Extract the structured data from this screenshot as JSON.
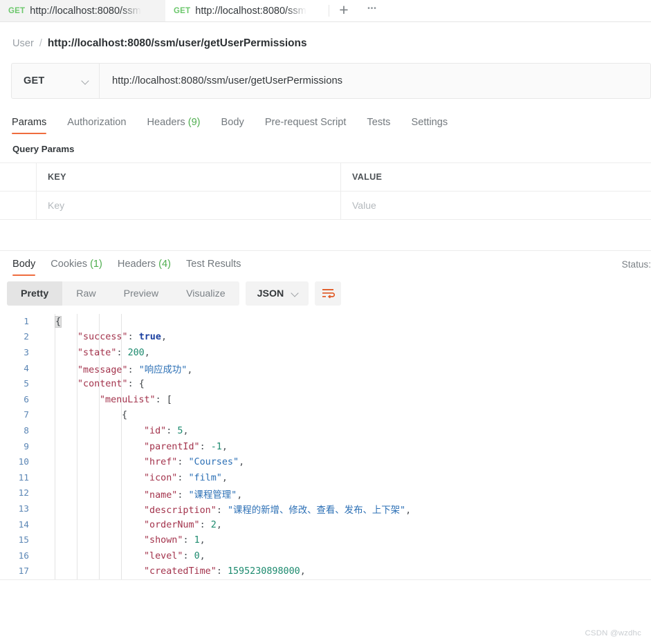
{
  "tabs": [
    {
      "method": "GET",
      "name": "http://localhost:8080/ssm",
      "active": false
    },
    {
      "method": "GET",
      "name": "http://localhost:8080/ssm",
      "active": true
    }
  ],
  "tabbar": {
    "new_tab": "+",
    "more": "•••"
  },
  "breadcrumb": {
    "root": "User",
    "separator": "/",
    "name": "http://localhost:8080/ssm/user/getUserPermissions"
  },
  "url_bar": {
    "method": "GET",
    "url": "http://localhost:8080/ssm/user/getUserPermissions"
  },
  "request_tabs": [
    {
      "label": "Params",
      "count": "",
      "selected": true
    },
    {
      "label": "Authorization",
      "count": "",
      "selected": false
    },
    {
      "label": "Headers",
      "count": "(9)",
      "selected": false
    },
    {
      "label": "Body",
      "count": "",
      "selected": false
    },
    {
      "label": "Pre-request Script",
      "count": "",
      "selected": false
    },
    {
      "label": "Tests",
      "count": "",
      "selected": false
    },
    {
      "label": "Settings",
      "count": "",
      "selected": false
    }
  ],
  "query_params": {
    "title": "Query Params",
    "columns": [
      "KEY",
      "VALUE"
    ],
    "rows": [
      {
        "key_placeholder": "Key",
        "value_placeholder": "Value"
      }
    ]
  },
  "response_tabs": [
    {
      "label": "Body",
      "count": "",
      "selected": true
    },
    {
      "label": "Cookies",
      "count": "(1)",
      "selected": false
    },
    {
      "label": "Headers",
      "count": "(4)",
      "selected": false
    },
    {
      "label": "Test Results",
      "count": "",
      "selected": false
    }
  ],
  "response_status": "Status:",
  "viewer_toolbar": {
    "modes": [
      "Pretty",
      "Raw",
      "Preview",
      "Visualize"
    ],
    "selected_mode": "Pretty",
    "format": "JSON",
    "wrap_icon": "wrap-lines-icon"
  },
  "colors": {
    "accent": "#ef6c3e",
    "green": "#4fae4f",
    "key": "#a3334c",
    "string": "#2b6fb5",
    "number": "#1c8a6e",
    "boolean": "#1a3fa0",
    "linenum": "#5b86b5"
  },
  "code_lines": [
    {
      "n": "1",
      "indent": 0,
      "tokens": [
        {
          "t": "{",
          "c": "br hl"
        }
      ]
    },
    {
      "n": "2",
      "indent": 1,
      "tokens": [
        {
          "t": "\"success\"",
          "c": "k"
        },
        {
          "t": ": ",
          "c": "p"
        },
        {
          "t": "true",
          "c": "b"
        },
        {
          "t": ",",
          "c": "p"
        }
      ]
    },
    {
      "n": "3",
      "indent": 1,
      "tokens": [
        {
          "t": "\"state\"",
          "c": "k"
        },
        {
          "t": ": ",
          "c": "p"
        },
        {
          "t": "200",
          "c": "n"
        },
        {
          "t": ",",
          "c": "p"
        }
      ]
    },
    {
      "n": "4",
      "indent": 1,
      "tokens": [
        {
          "t": "\"message\"",
          "c": "k"
        },
        {
          "t": ": ",
          "c": "p"
        },
        {
          "t": "\"响应成功\"",
          "c": "s"
        },
        {
          "t": ",",
          "c": "p"
        }
      ]
    },
    {
      "n": "5",
      "indent": 1,
      "tokens": [
        {
          "t": "\"content\"",
          "c": "k"
        },
        {
          "t": ": ",
          "c": "p"
        },
        {
          "t": "{",
          "c": "br"
        }
      ]
    },
    {
      "n": "6",
      "indent": 2,
      "tokens": [
        {
          "t": "\"menuList\"",
          "c": "k"
        },
        {
          "t": ": ",
          "c": "p"
        },
        {
          "t": "[",
          "c": "br"
        }
      ]
    },
    {
      "n": "7",
      "indent": 3,
      "tokens": [
        {
          "t": "{",
          "c": "br"
        }
      ]
    },
    {
      "n": "8",
      "indent": 4,
      "tokens": [
        {
          "t": "\"id\"",
          "c": "k"
        },
        {
          "t": ": ",
          "c": "p"
        },
        {
          "t": "5",
          "c": "n"
        },
        {
          "t": ",",
          "c": "p"
        }
      ]
    },
    {
      "n": "9",
      "indent": 4,
      "tokens": [
        {
          "t": "\"parentId\"",
          "c": "k"
        },
        {
          "t": ": ",
          "c": "p"
        },
        {
          "t": "-1",
          "c": "n"
        },
        {
          "t": ",",
          "c": "p"
        }
      ]
    },
    {
      "n": "10",
      "indent": 4,
      "tokens": [
        {
          "t": "\"href\"",
          "c": "k"
        },
        {
          "t": ": ",
          "c": "p"
        },
        {
          "t": "\"Courses\"",
          "c": "s"
        },
        {
          "t": ",",
          "c": "p"
        }
      ]
    },
    {
      "n": "11",
      "indent": 4,
      "tokens": [
        {
          "t": "\"icon\"",
          "c": "k"
        },
        {
          "t": ": ",
          "c": "p"
        },
        {
          "t": "\"film\"",
          "c": "s"
        },
        {
          "t": ",",
          "c": "p"
        }
      ]
    },
    {
      "n": "12",
      "indent": 4,
      "tokens": [
        {
          "t": "\"name\"",
          "c": "k"
        },
        {
          "t": ": ",
          "c": "p"
        },
        {
          "t": "\"课程管理\"",
          "c": "s"
        },
        {
          "t": ",",
          "c": "p"
        }
      ]
    },
    {
      "n": "13",
      "indent": 4,
      "tokens": [
        {
          "t": "\"description\"",
          "c": "k"
        },
        {
          "t": ": ",
          "c": "p"
        },
        {
          "t": "\"课程的新增、修改、查看、发布、上下架\"",
          "c": "s"
        },
        {
          "t": ",",
          "c": "p"
        }
      ]
    },
    {
      "n": "14",
      "indent": 4,
      "tokens": [
        {
          "t": "\"orderNum\"",
          "c": "k"
        },
        {
          "t": ": ",
          "c": "p"
        },
        {
          "t": "2",
          "c": "n"
        },
        {
          "t": ",",
          "c": "p"
        }
      ]
    },
    {
      "n": "15",
      "indent": 4,
      "tokens": [
        {
          "t": "\"shown\"",
          "c": "k"
        },
        {
          "t": ": ",
          "c": "p"
        },
        {
          "t": "1",
          "c": "n"
        },
        {
          "t": ",",
          "c": "p"
        }
      ]
    },
    {
      "n": "16",
      "indent": 4,
      "tokens": [
        {
          "t": "\"level\"",
          "c": "k"
        },
        {
          "t": ": ",
          "c": "p"
        },
        {
          "t": "0",
          "c": "n"
        },
        {
          "t": ",",
          "c": "p"
        }
      ]
    },
    {
      "n": "17",
      "indent": 4,
      "tokens": [
        {
          "t": "\"createdTime\"",
          "c": "k"
        },
        {
          "t": ": ",
          "c": "p"
        },
        {
          "t": "1595230898000",
          "c": "n"
        },
        {
          "t": ",",
          "c": "p"
        }
      ]
    }
  ],
  "watermark": "CSDN @wzdhc"
}
